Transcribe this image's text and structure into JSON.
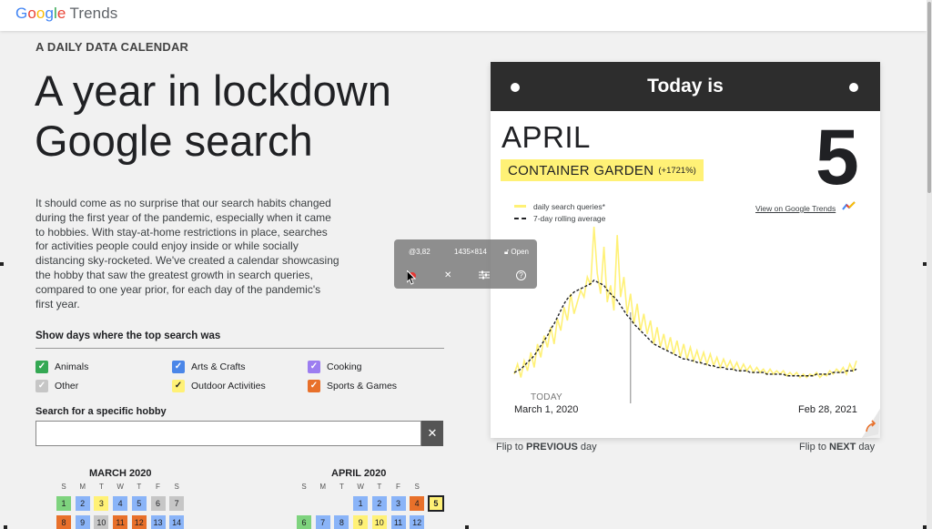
{
  "brand": {
    "g1": "G",
    "g2": "o",
    "g3": "o",
    "g4": "g",
    "g5": "l",
    "g6": "e",
    "product": "Trends"
  },
  "eyebrow": "A DAILY DATA CALENDAR",
  "headline": {
    "line1": "A year in lockdown",
    "line2": "Google search"
  },
  "intro": "It should come as no surprise that our search habits changed during the first year of the pandemic, especially when it came to hobbies. With stay-at-home restrictions in place, searches for activities people could enjoy inside or while socially distancing sky-rocketed. We've created a calendar showcasing the hobby that saw the greatest growth in search queries, compared to one year prior, for each day of the pandemic's first year.",
  "filters": {
    "label": "Show days where the top search was",
    "items": [
      {
        "label": "Animals",
        "color": "#34a853",
        "check": "✓"
      },
      {
        "label": "Arts & Crafts",
        "color": "#4a86e8",
        "check": "✓"
      },
      {
        "label": "Cooking",
        "color": "#9c7df0",
        "check": "✓"
      },
      {
        "label": "Other",
        "color": "#c6c6c6",
        "check": "✓"
      },
      {
        "label": "Outdoor Activities",
        "color": "#fff176",
        "check": "✓"
      },
      {
        "label": "Sports & Games",
        "color": "#e8702a",
        "check": "✓"
      }
    ]
  },
  "search": {
    "label": "Search for a specific hobby",
    "value": "",
    "placeholder": "",
    "clear": "✕"
  },
  "calendars": [
    {
      "title": "MARCH 2020",
      "dow": [
        "S",
        "M",
        "T",
        "W",
        "T",
        "F",
        "S"
      ],
      "rows": [
        [
          {
            "d": "1",
            "c": "#7ed37e"
          },
          {
            "d": "2",
            "c": "#8ab4f8"
          },
          {
            "d": "3",
            "c": "#fff176"
          },
          {
            "d": "4",
            "c": "#8ab4f8"
          },
          {
            "d": "5",
            "c": "#8ab4f8"
          },
          {
            "d": "6",
            "c": "#c6c6c6"
          },
          {
            "d": "7",
            "c": "#c6c6c6"
          }
        ],
        [
          {
            "d": "8",
            "c": "#e8702a"
          },
          {
            "d": "9",
            "c": "#8ab4f8"
          },
          {
            "d": "10",
            "c": "#c6c6c6"
          },
          {
            "d": "11",
            "c": "#e8702a"
          },
          {
            "d": "12",
            "c": "#e8702a"
          },
          {
            "d": "13",
            "c": "#8ab4f8"
          },
          {
            "d": "14",
            "c": "#8ab4f8"
          }
        ]
      ]
    },
    {
      "title": "APRIL 2020",
      "dow": [
        "S",
        "M",
        "T",
        "W",
        "T",
        "F",
        "S"
      ],
      "rows": [
        [
          null,
          null,
          null,
          {
            "d": "1",
            "c": "#8ab4f8"
          },
          {
            "d": "2",
            "c": "#8ab4f8"
          },
          {
            "d": "3",
            "c": "#8ab4f8"
          },
          {
            "d": "4",
            "c": "#e8702a"
          },
          {
            "d": "5",
            "c": "#fff176",
            "selected": true
          }
        ],
        [
          {
            "d": "6",
            "c": "#7ed37e"
          },
          {
            "d": "7",
            "c": "#8ab4f8"
          },
          {
            "d": "8",
            "c": "#8ab4f8"
          },
          {
            "d": "9",
            "c": "#fff176"
          },
          {
            "d": "10",
            "c": "#fff176"
          },
          {
            "d": "11",
            "c": "#8ab4f8"
          },
          {
            "d": "12",
            "c": "#8ab4f8"
          }
        ]
      ]
    }
  ],
  "card": {
    "header": "Today is",
    "month": "APRIL",
    "day": "5",
    "hobby": "CONTAINER GARDEN",
    "growth": "(+1721%)",
    "link": "View on Google Trends",
    "today_label": "TODAY",
    "start_date": "March 1, 2020",
    "end_date": "Feb 28, 2021"
  },
  "chart_data": {
    "type": "line",
    "series": [
      {
        "name": "daily search queries*",
        "color": "#fff176"
      },
      {
        "name": "7-day rolling average",
        "color": "#202124",
        "dash": true
      }
    ],
    "x_range": [
      "March 1, 2020",
      "Feb 28, 2021"
    ],
    "daily_values": [
      12,
      18,
      10,
      20,
      14,
      25,
      16,
      30,
      22,
      35,
      28,
      40,
      30,
      45,
      38,
      52,
      44,
      60,
      48,
      55,
      62,
      58,
      70,
      65,
      100,
      72,
      60,
      88,
      55,
      65,
      50,
      95,
      58,
      70,
      48,
      60,
      42,
      54,
      38,
      48,
      36,
      44,
      30,
      40,
      28,
      36,
      26,
      34,
      24,
      32,
      22,
      30,
      21,
      28,
      20,
      26,
      19,
      25,
      18,
      24,
      17,
      22,
      16,
      21,
      16,
      20,
      15,
      19,
      14,
      18,
      14,
      17,
      13,
      16,
      13,
      15,
      12,
      15,
      12,
      14,
      12,
      14,
      11,
      13,
      11,
      13,
      10,
      12,
      10,
      12,
      11,
      13,
      10,
      12,
      11,
      14,
      12,
      15,
      13,
      16,
      12,
      18,
      14,
      20
    ],
    "avg_values": [
      13,
      14,
      15,
      17,
      19,
      21,
      23,
      26,
      29,
      32,
      35,
      39,
      42,
      46,
      50,
      54,
      57,
      59,
      61,
      62,
      63,
      64,
      65,
      66,
      68,
      67,
      66,
      65,
      62,
      60,
      58,
      56,
      53,
      50,
      47,
      45,
      42,
      40,
      38,
      36,
      34,
      32,
      30,
      29,
      28,
      27,
      26,
      25,
      24,
      23,
      22,
      21,
      21,
      20,
      20,
      19,
      19,
      18,
      18,
      17,
      17,
      16,
      16,
      16,
      15,
      15,
      15,
      14,
      14,
      14,
      14,
      13,
      13,
      13,
      13,
      13,
      12,
      12,
      12,
      12,
      12,
      12,
      11,
      11,
      11,
      11,
      11,
      11,
      11,
      11,
      11,
      12,
      12,
      12,
      12,
      12,
      13,
      13,
      13,
      13,
      14,
      14,
      14,
      15
    ],
    "today_index": 35
  },
  "flip": {
    "prev_prefix": "Flip to ",
    "prev_bold": "PREVIOUS",
    "prev_suffix": " day",
    "next_prefix": "Flip to ",
    "next_bold": "NEXT",
    "next_suffix": " day"
  },
  "recorder": {
    "coords": "@3,82",
    "size": "1435×814",
    "open": "Open",
    "close": "✕",
    "help": "?"
  }
}
